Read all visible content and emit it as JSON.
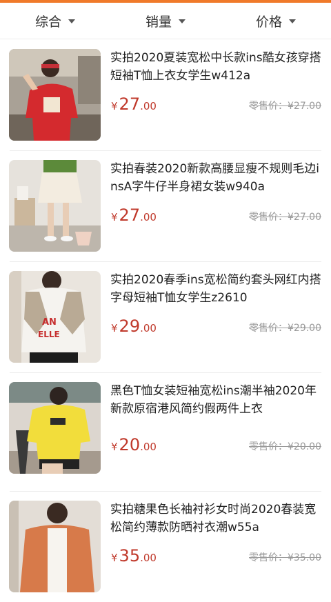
{
  "sort_bar": {
    "items": [
      {
        "label": "综合"
      },
      {
        "label": "销量"
      },
      {
        "label": "价格"
      }
    ]
  },
  "colors": {
    "accent": "#f07a2a",
    "price": "#c0392b",
    "retail": "#9a9a9a"
  },
  "products": [
    {
      "title": "实拍2020夏装宽松中长款ins酷女孩穿搭短袖T恤上衣女学生w412a",
      "currency": "¥",
      "price_int": "27",
      "price_dec": ".00",
      "retail": "零售价：¥27.00",
      "image": "model-red-tshirt-photo"
    },
    {
      "title": "实拍春装2020新款高腰显瘦不规则毛边insA字牛仔半身裙女装w940a",
      "currency": "¥",
      "price_int": "27",
      "price_dec": ".00",
      "retail": "零售价：¥27.00",
      "image": "model-denim-skirt-photo"
    },
    {
      "title": "实拍2020春季ins宽松简约套头网红内搭字母短袖T恤女学生z2610",
      "currency": "¥",
      "price_int": "29",
      "price_dec": ".00",
      "retail": "零售价：¥29.00",
      "image": "model-white-letter-tshirt-photo"
    },
    {
      "title": "黑色T恤女装短袖宽松ins潮半袖2020年新款原宿港风简约假两件上衣",
      "currency": "¥",
      "price_int": "20",
      "price_dec": ".00",
      "retail": "零售价：¥20.00",
      "image": "model-yellow-tshirt-photo"
    },
    {
      "title": "实拍糖果色长袖衬衫女时尚2020春装宽松简约薄款防晒衬衣潮w55a",
      "currency": "¥",
      "price_int": "35",
      "price_dec": ".00",
      "retail": "零售价：¥35.00",
      "image": "model-orange-shirt-photo"
    }
  ]
}
